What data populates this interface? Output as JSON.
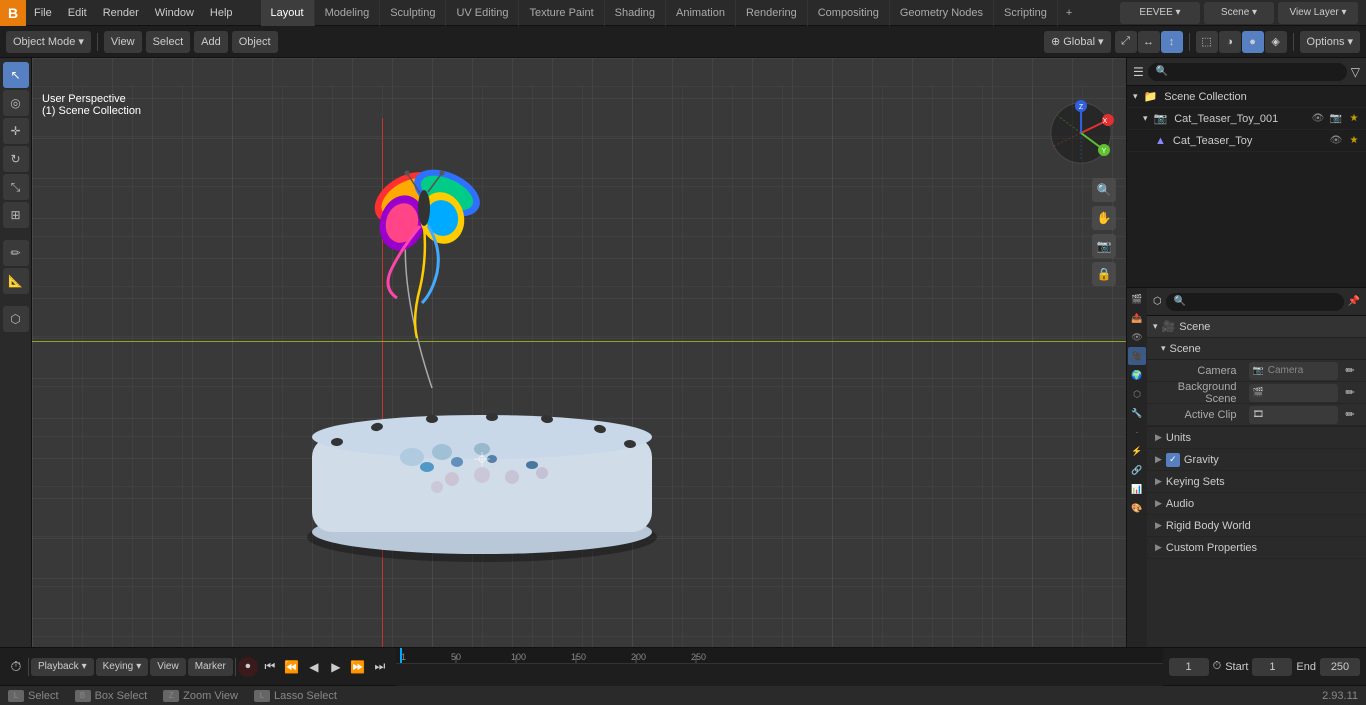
{
  "app": {
    "logo": "B",
    "menu_items": [
      "File",
      "Edit",
      "Render",
      "Window",
      "Help"
    ]
  },
  "workspace_tabs": [
    {
      "label": "Layout",
      "active": true
    },
    {
      "label": "Modeling",
      "active": false
    },
    {
      "label": "Sculpting",
      "active": false
    },
    {
      "label": "UV Editing",
      "active": false
    },
    {
      "label": "Texture Paint",
      "active": false
    },
    {
      "label": "Shading",
      "active": false
    },
    {
      "label": "Animation",
      "active": false
    },
    {
      "label": "Rendering",
      "active": false
    },
    {
      "label": "Compositing",
      "active": false
    },
    {
      "label": "Geometry Nodes",
      "active": false
    },
    {
      "label": "Scripting",
      "active": false
    }
  ],
  "viewport_header": {
    "mode_btn": "Object Mode",
    "view_btn": "View",
    "select_btn": "Select",
    "add_btn": "Add",
    "object_btn": "Object",
    "transform_btn": "Global",
    "options_btn": "Options"
  },
  "viewport_info": {
    "line1": "User Perspective",
    "line2": "(1) Scene Collection"
  },
  "outliner": {
    "title": "Scene Collection",
    "items": [
      {
        "name": "Scene Collection",
        "icon": "📁",
        "level": 0
      },
      {
        "name": "Cat_Teaser_Toy_001",
        "icon": "📷",
        "level": 1
      },
      {
        "name": "Cat_Teaser_Toy",
        "icon": "▲",
        "level": 2
      }
    ]
  },
  "properties": {
    "tabs": [
      "render",
      "output",
      "view",
      "scene",
      "world",
      "object",
      "modifier",
      "particles",
      "physics",
      "constraints",
      "object_data",
      "material",
      "color"
    ],
    "active_tab": "scene",
    "scene_label": "Scene",
    "sections": {
      "scene_header": "Scene",
      "camera_label": "Camera",
      "background_scene_label": "Background Scene",
      "active_clip_label": "Active Clip",
      "sub_sections": [
        {
          "label": "Units",
          "expanded": false
        },
        {
          "label": "Gravity",
          "expanded": false,
          "checkbox": true
        },
        {
          "label": "Keying Sets",
          "expanded": false
        },
        {
          "label": "Audio",
          "expanded": false
        },
        {
          "label": "Rigid Body World",
          "expanded": false
        },
        {
          "label": "Custom Properties",
          "expanded": false
        }
      ]
    }
  },
  "timeline": {
    "playback_btn": "Playback",
    "keying_btn": "Keying",
    "view_btn": "View",
    "marker_btn": "Marker",
    "current_frame": "1",
    "start_label": "Start",
    "start_frame": "1",
    "end_label": "End",
    "end_frame": "250",
    "ruler_marks": [
      "1",
      "50",
      "100",
      "150",
      "200",
      "250"
    ]
  },
  "status_bar": {
    "select_label": "Select",
    "box_select_label": "Box Select",
    "zoom_view_label": "Zoom View",
    "lasso_select_label": "Lasso Select",
    "version": "2.93.11"
  }
}
